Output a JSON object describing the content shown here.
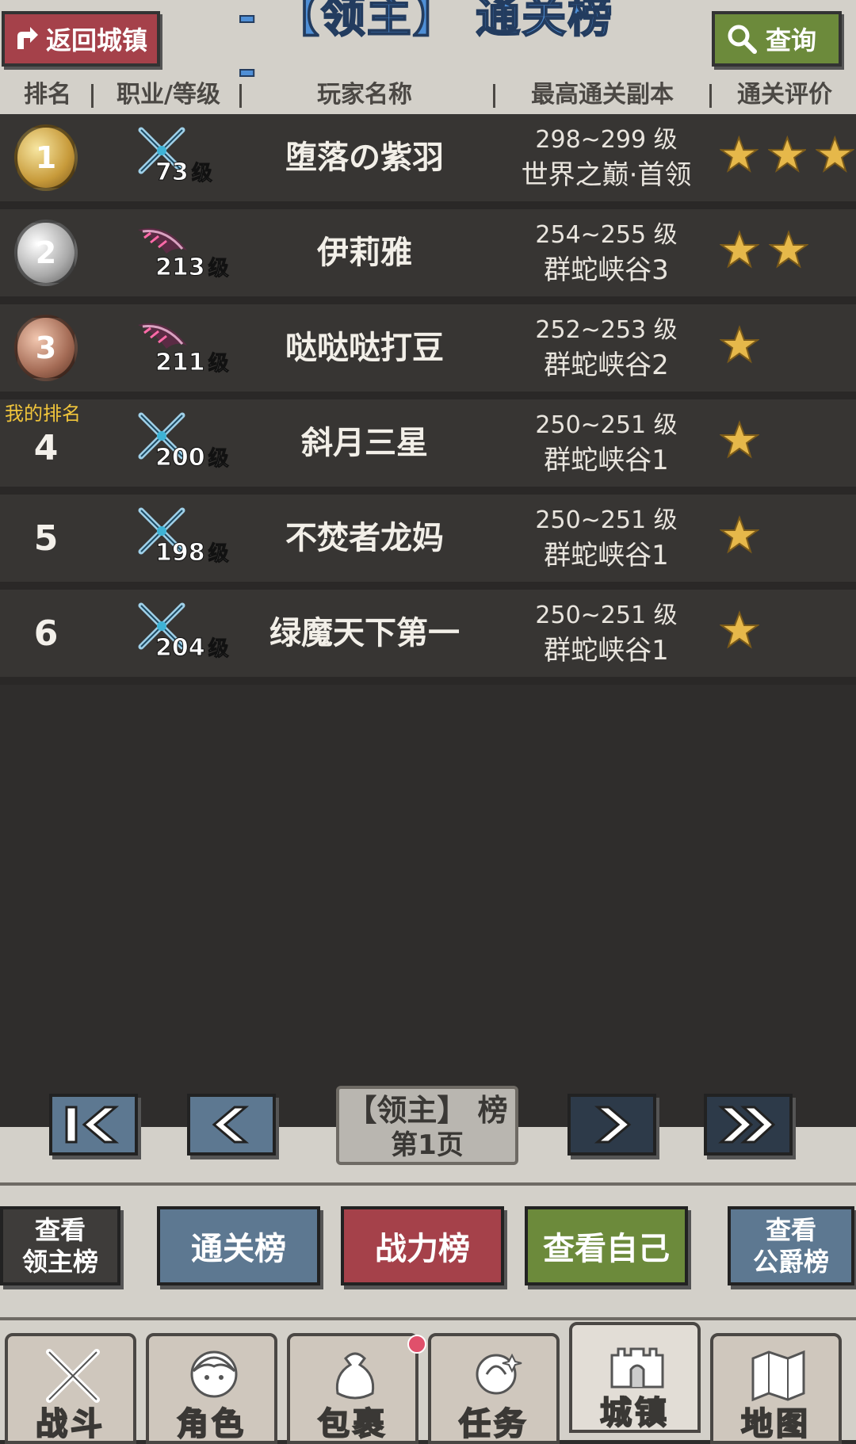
{
  "header": {
    "back_label": "返回城镇",
    "title": "- 【领主】 通关榜 -",
    "query_label": "查询"
  },
  "columns": [
    "排名",
    "职业/等级",
    "玩家名称",
    "最高通关副本",
    "通关评价"
  ],
  "my_rank_label": "我的排名",
  "level_unit": "级",
  "rows": [
    {
      "rank": "1",
      "medal": "gold",
      "job": "swords",
      "level": "73",
      "name": "堕落の紫羽",
      "range": "298~299 级",
      "dungeon": "世界之巅·首领",
      "stars": 3
    },
    {
      "rank": "2",
      "medal": "silver",
      "job": "blade",
      "level": "213",
      "name": "伊莉雅",
      "range": "254~255 级",
      "dungeon": "群蛇峡谷3",
      "stars": 2
    },
    {
      "rank": "3",
      "medal": "bronze",
      "job": "blade",
      "level": "211",
      "name": "哒哒哒打豆",
      "range": "252~253 级",
      "dungeon": "群蛇峡谷2",
      "stars": 1
    },
    {
      "rank": "4",
      "medal": "",
      "job": "swords",
      "level": "200",
      "name": "斜月三星",
      "range": "250~251 级",
      "dungeon": "群蛇峡谷1",
      "stars": 1
    },
    {
      "rank": "5",
      "medal": "",
      "job": "swords",
      "level": "198",
      "name": "不焚者龙妈",
      "range": "250~251 级",
      "dungeon": "群蛇峡谷1",
      "stars": 1
    },
    {
      "rank": "6",
      "medal": "",
      "job": "swords",
      "level": "204",
      "name": "绿魔天下第一",
      "range": "250~251 级",
      "dungeon": "群蛇峡谷1",
      "stars": 1
    }
  ],
  "pager": {
    "label_line1": "【领主】 榜",
    "label_line2": "第1页"
  },
  "ranking_buttons": {
    "lord_line1": "查看",
    "lord_line2": "领主榜",
    "clear": "通关榜",
    "power": "战力榜",
    "self": "查看自己",
    "duke_line1": "查看",
    "duke_line2": "公爵榜"
  },
  "nav": {
    "battle": "战斗",
    "role": "角色",
    "bag": "包裹",
    "quest": "任务",
    "town": "城镇",
    "map": "地图"
  },
  "colors": {
    "accent_blue": "#4f8fd6",
    "back_red": "#a5414a",
    "query_green": "#6c8a3b",
    "star": "#e6b84a",
    "my_rank": "#f0c53b"
  }
}
